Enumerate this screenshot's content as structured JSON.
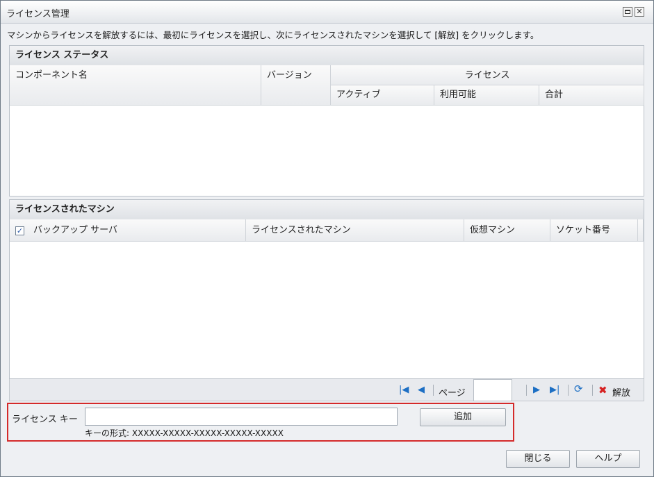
{
  "window": {
    "title": "ライセンス管理",
    "description": "マシンからライセンスを解放するには、最初にライセンスを選択し、次にライセンスされたマシンを選択して [解放] をクリックします。"
  },
  "license_status": {
    "title": "ライセンス ステータス",
    "columns": {
      "component": "コンポーネント名",
      "version": "バージョン",
      "license_group": "ライセンス",
      "active": "アクティブ",
      "available": "利用可能",
      "total": "合計"
    },
    "rows": []
  },
  "licensed_machines": {
    "title": "ライセンスされたマシン",
    "select_all_checked": true,
    "columns": {
      "backup_server": "バックアップ サーバ",
      "machine": "ライセンスされたマシン",
      "vm": "仮想マシン",
      "socket": "ソケット番号"
    },
    "rows": []
  },
  "pager": {
    "page_label": "ページ",
    "page_value": "",
    "release_label": "解放",
    "icons": [
      "first-page-icon",
      "prev-page-icon",
      "next-page-icon",
      "last-page-icon",
      "refresh-icon",
      "release-x-icon"
    ]
  },
  "license_key": {
    "label": "ライセンス キー",
    "value": "",
    "format_hint": "キーの形式: XXXXX-XXXXX-XXXXX-XXXXX-XXXXX",
    "add_label": "追加"
  },
  "footer": {
    "close_label": "閉じる",
    "help_label": "ヘルプ"
  },
  "colors": {
    "highlight_border": "#d42a2a",
    "icon_blue": "#1d6fc4",
    "release_red": "#d62222"
  }
}
